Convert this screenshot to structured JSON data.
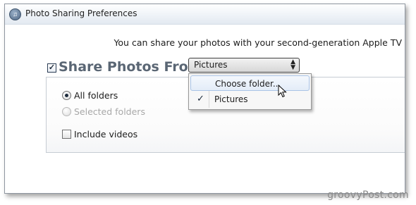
{
  "window": {
    "title": "Photo Sharing Preferences",
    "app_icon": "itunes-icon"
  },
  "main": {
    "share_info": "You can share your photos with your second-generation Apple TV",
    "share_label": "Share Photos From:",
    "share_checked": true,
    "source_select": {
      "value": "Pictures",
      "options": [
        {
          "label": "Choose folder...",
          "highlighted": true,
          "checked": false
        },
        {
          "label": "Pictures",
          "highlighted": false,
          "checked": true
        }
      ]
    },
    "options": {
      "all_folders": "All folders",
      "selected_folders": "Selected folders",
      "include_videos": "Include videos"
    }
  },
  "watermark": "groovyPost.com"
}
